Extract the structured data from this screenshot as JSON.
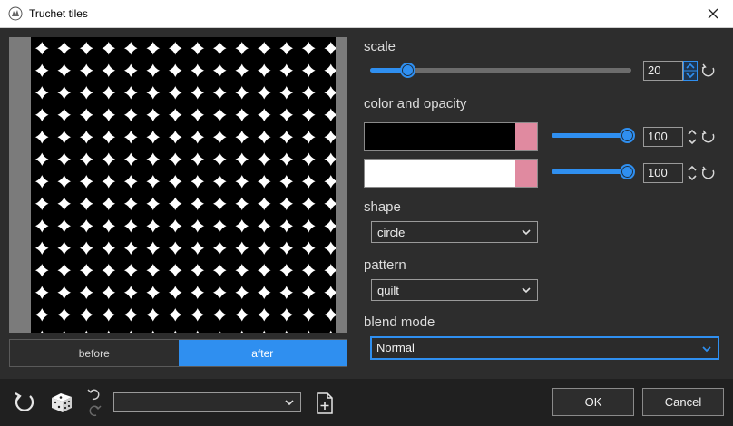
{
  "window": {
    "title": "Truchet tiles"
  },
  "preview": {
    "tabs": [
      {
        "label": "before",
        "active": false
      },
      {
        "label": "after",
        "active": true
      }
    ]
  },
  "scale": {
    "label": "scale",
    "value": "20",
    "slider_fraction": 0.14
  },
  "color_opacity": {
    "label": "color and opacity",
    "colors": [
      {
        "color": "#000000",
        "opacity": "100",
        "slider_fraction": 1.0
      },
      {
        "color": "#ffffff",
        "opacity": "100",
        "slider_fraction": 1.0
      }
    ],
    "alpha_color": "#e08aa0"
  },
  "shape": {
    "label": "shape",
    "value": "circle"
  },
  "pattern": {
    "label": "pattern",
    "value": "quilt"
  },
  "blend_mode": {
    "label": "blend mode",
    "value": "Normal"
  },
  "footer": {
    "preset_value": "",
    "ok_label": "OK",
    "cancel_label": "Cancel"
  },
  "colors": {
    "accent": "#2f8ff0",
    "panel": "#2d2d2d"
  },
  "icons": [
    "app-icon",
    "close-icon",
    "reset-icon",
    "dice-icon",
    "undo-icon",
    "redo-icon",
    "chevron-down-icon",
    "new-preset-icon"
  ]
}
